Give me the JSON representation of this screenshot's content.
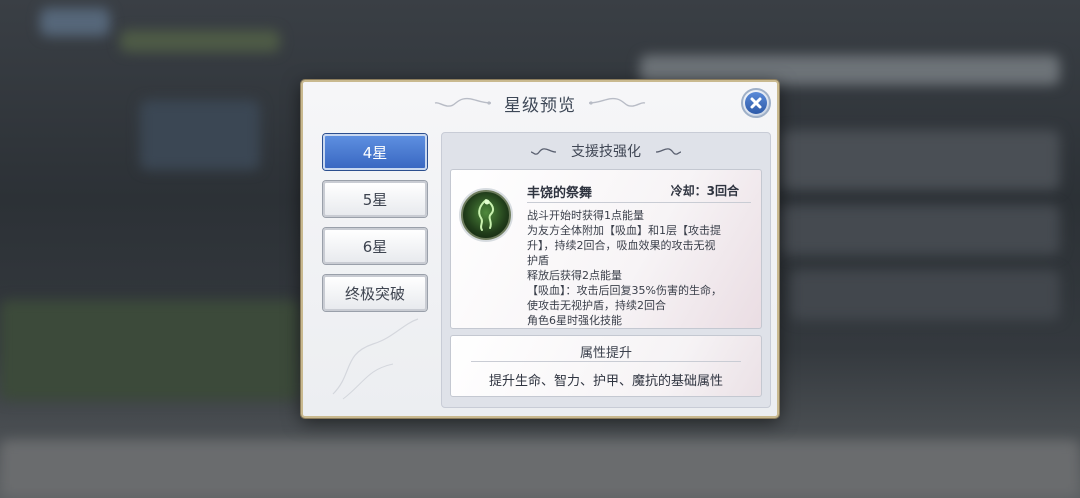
{
  "dialog": {
    "title": "星级预览",
    "close_icon": "close-icon"
  },
  "tabs": [
    {
      "label": "4星",
      "active": true
    },
    {
      "label": "5星",
      "active": false
    },
    {
      "label": "6星",
      "active": false
    },
    {
      "label": "终极突破",
      "active": false
    }
  ],
  "panel": {
    "section_title": "支援技强化",
    "skill": {
      "icon": "dragon-skill-icon",
      "name": "丰饶的祭舞",
      "cooldown": "冷却：3回合",
      "description_lines": [
        "战斗开始时获得1点能量",
        "为友方全体附加【吸血】和1层【攻击提",
        "升】，持续2回合，吸血效果的攻击无视",
        "护盾",
        "释放后获得2点能量",
        "【吸血】：攻击后回复35%伤害的生命，",
        "使攻击无视护盾，持续2回合",
        "角色6星时强化技能"
      ]
    },
    "attr": {
      "title": "属性提升",
      "text": "提升生命、智力、护甲、魔抗的基础属性"
    }
  },
  "colors": {
    "active_tab": "#3a68c2",
    "dialog_border": "#c9b98f"
  }
}
